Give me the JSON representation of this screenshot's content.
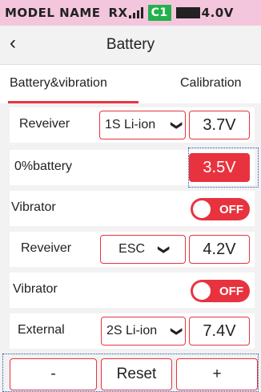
{
  "status": {
    "model": "MODEL NAME",
    "rx": "RX",
    "channel": "C1",
    "voltage": "4.0V"
  },
  "header": {
    "title": "Battery",
    "back_icon": "‹"
  },
  "tabs": [
    {
      "label": "Battery&vibration"
    },
    {
      "label": "Calibration"
    }
  ],
  "rows": [
    {
      "label": "Reveiver",
      "select": "1S Li-ion",
      "value": "3.7V"
    },
    {
      "label": "0%battery",
      "value": "3.5V"
    },
    {
      "label": "Vibrator",
      "toggle": "OFF"
    },
    {
      "label": "Reveiver",
      "select": "ESC",
      "value": "4.2V"
    },
    {
      "label": "Vibrator",
      "toggle": "OFF"
    },
    {
      "label": "External",
      "select": "2S Li-ion",
      "value": "7.4V"
    }
  ],
  "buttons": {
    "minus": "-",
    "reset": "Reset",
    "plus": "+"
  },
  "colors": {
    "accent": "#e8333f",
    "status_bg": "#f4c6de",
    "signal_green": "#22b24c"
  }
}
